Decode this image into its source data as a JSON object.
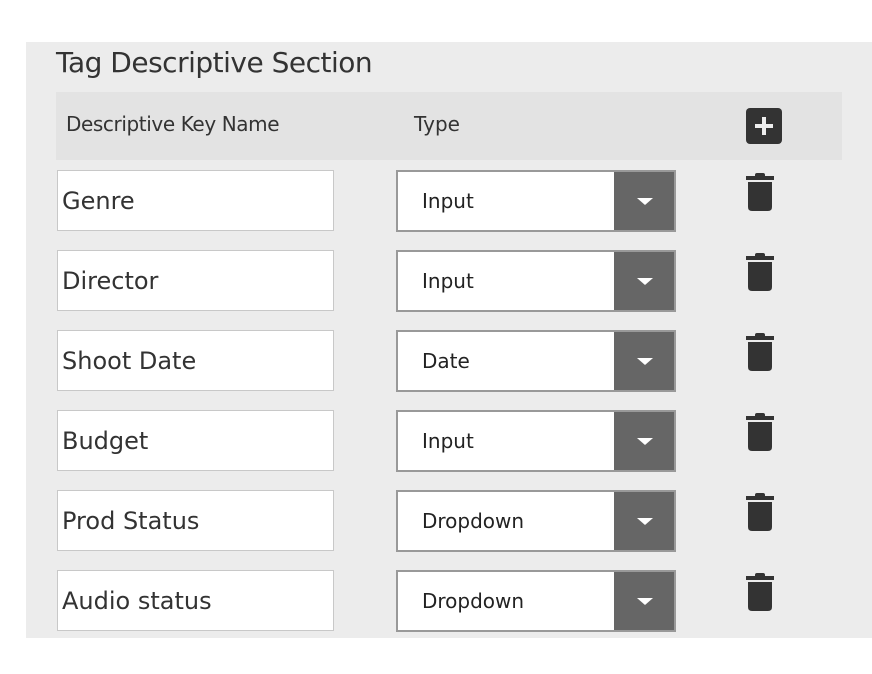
{
  "section": {
    "title": "Tag Descriptive Section"
  },
  "header": {
    "key_name": "Descriptive Key Name",
    "type": "Type",
    "add_icon": "plus-square-icon"
  },
  "rows": [
    {
      "key": "Genre",
      "type": "Input"
    },
    {
      "key": "Director",
      "type": "Input"
    },
    {
      "key": "Shoot Date",
      "type": "Date"
    },
    {
      "key": "Budget",
      "type": "Input"
    },
    {
      "key": "Prod Status",
      "type": "Dropdown"
    },
    {
      "key": "Audio status",
      "type": "Dropdown"
    }
  ]
}
